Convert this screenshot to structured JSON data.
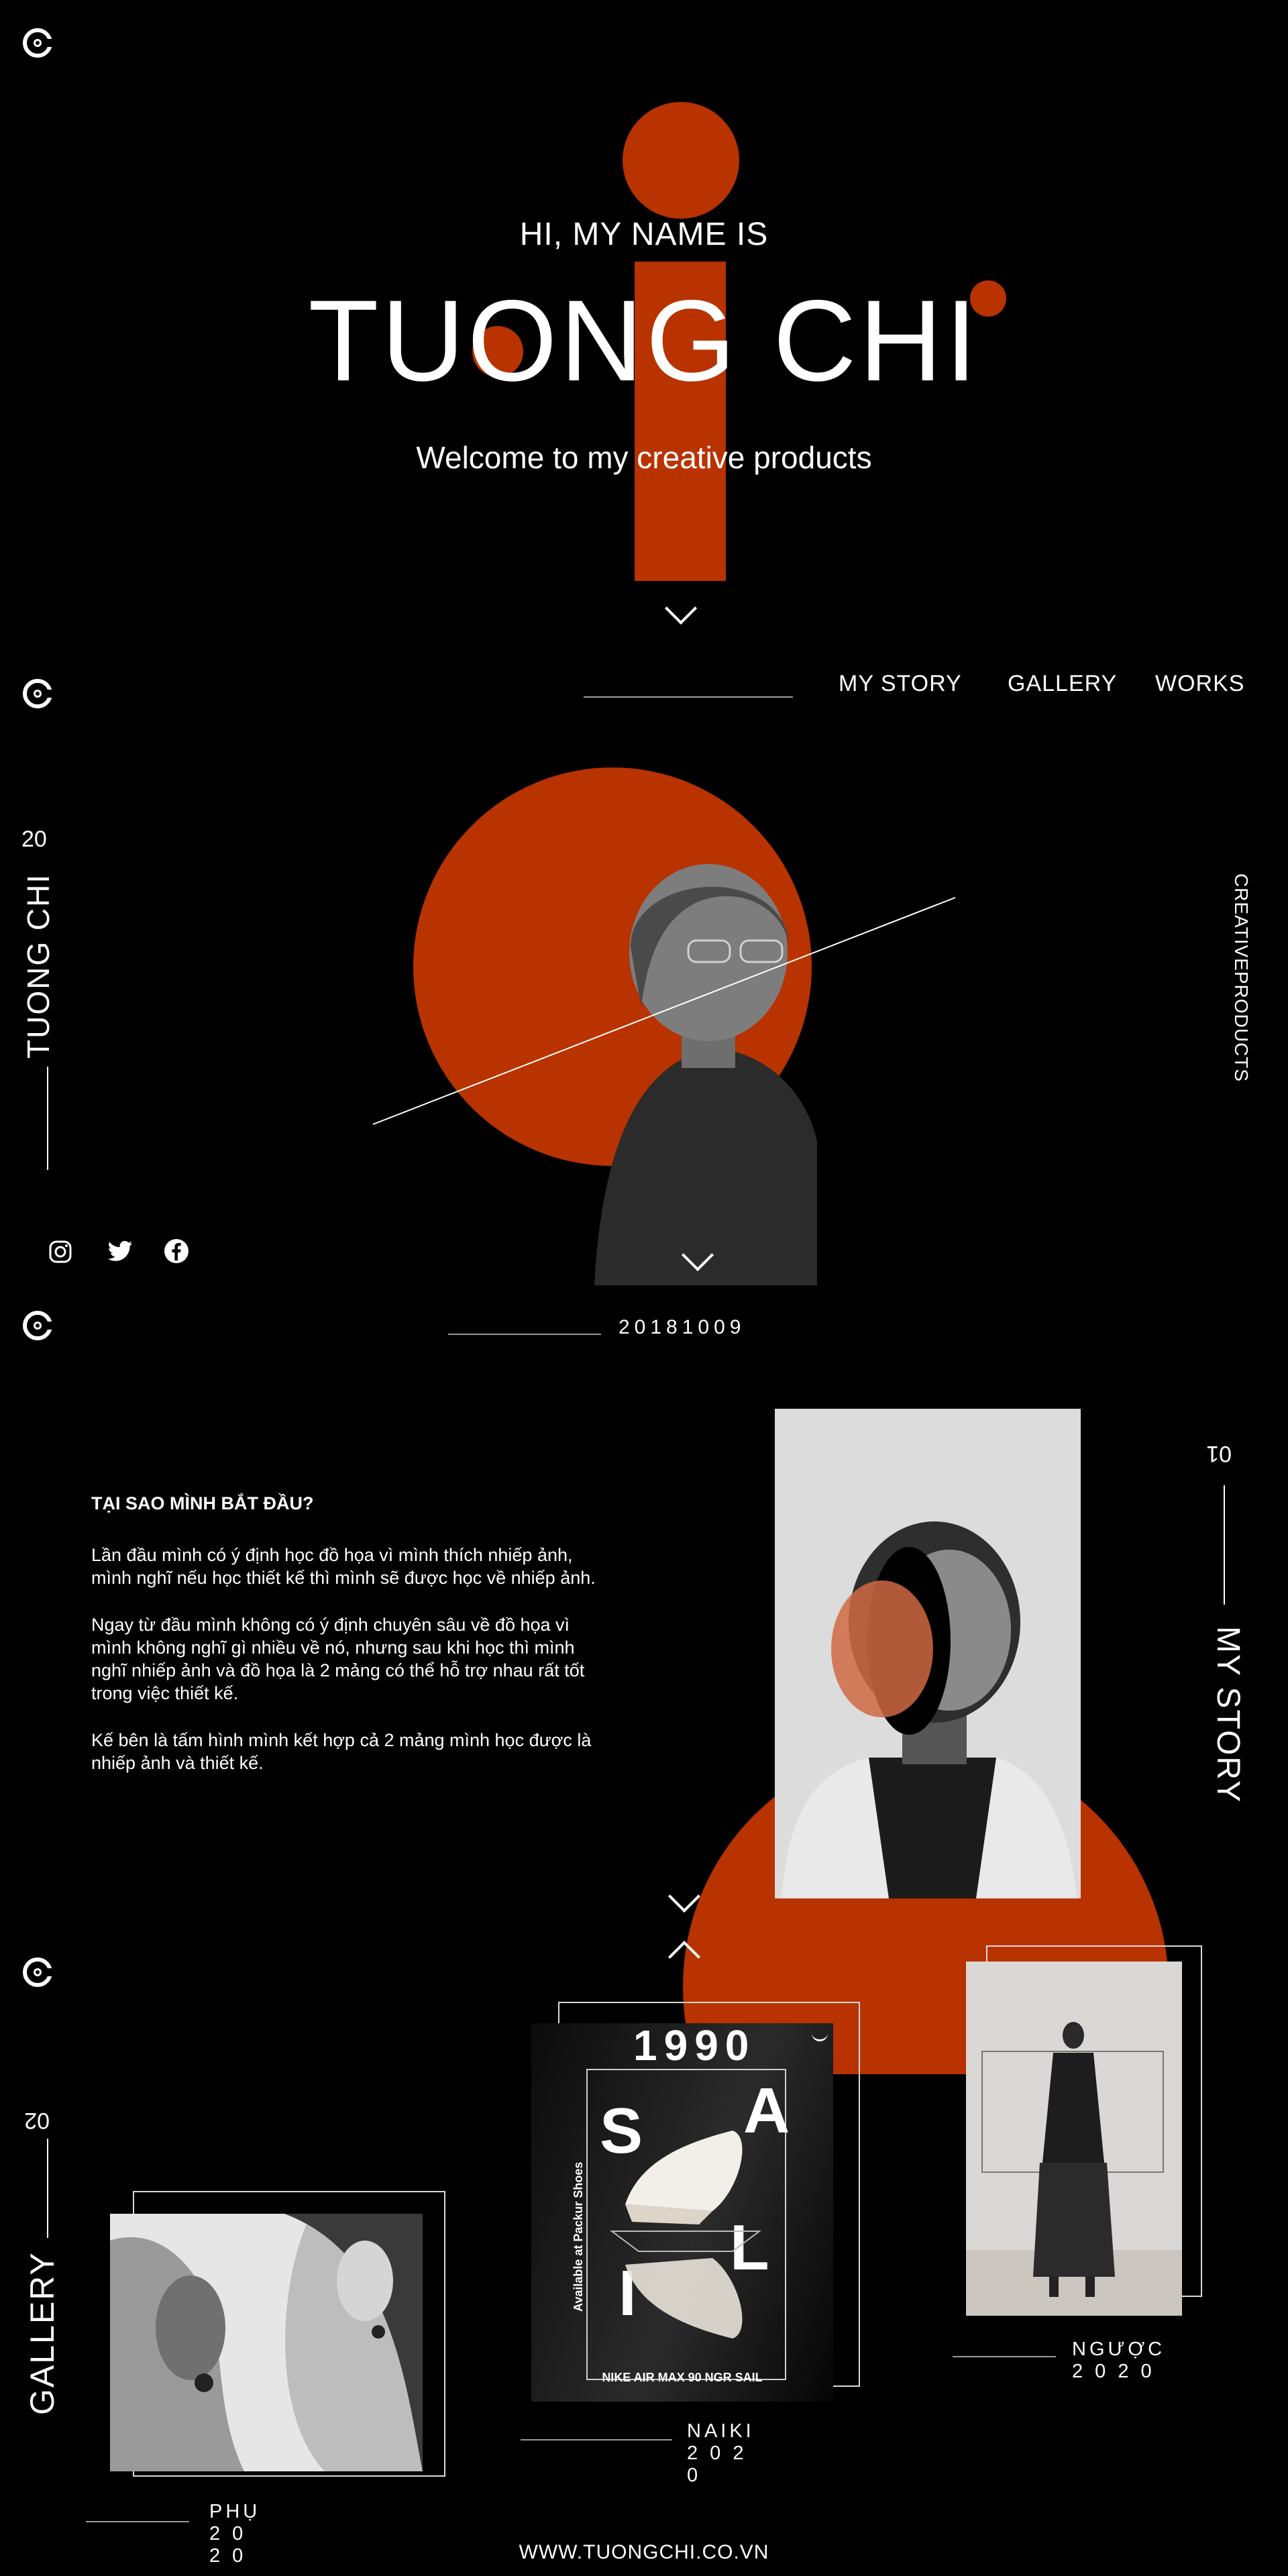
{
  "hero": {
    "greeting": "HI, MY NAME IS",
    "name": "TUONG CHI",
    "tagline": "Welcome to my creative products"
  },
  "nav": {
    "items": [
      "MY STORY",
      "GALLERY",
      "WORKS"
    ]
  },
  "intro": {
    "side_name": "TUONG CHI",
    "side_number": "20",
    "side_right": "CREATIVEPRODUCTS",
    "date": "20181009",
    "social": [
      "instagram-icon",
      "twitter-icon",
      "facebook-icon"
    ]
  },
  "story": {
    "heading": "TẠI SAO MÌNH BẮT ĐẦU?",
    "paragraphs": [
      "Lần đầu mình có ý định học đồ họa vì mình thích nhiếp ảnh, mình nghĩ nếu học thiết kế thì mình sẽ được học về nhiếp ảnh.",
      "Ngay từ đầu mình không có ý định chuyên sâu về đồ họa vì mình không nghĩ gì nhiều về nó, nhưng  sau khi học thì mình nghĩ nhiếp ảnh và đồ họa là 2 mảng có thể hỗ trợ nhau rất tốt trong việc thiết kế.",
      "Kế bên là tấm hình mình kết hợp cả 2 mảng mình học được là nhiếp ảnh và thiết kế."
    ],
    "number": "01",
    "side_title": "MY STORY"
  },
  "gallery": {
    "number": "02",
    "side_title": "GALLERY",
    "items": [
      {
        "caption": "PHỤ 2 0 2 0"
      },
      {
        "caption": "NAIKI 2 0 2 0"
      },
      {
        "caption": "NGƯỢC 2 0 2 0"
      }
    ],
    "poster": {
      "year": "1990",
      "letters": [
        "S",
        "A",
        "L",
        "I"
      ],
      "side_text": "Available at Packur Shoes",
      "product": "NIKE AIR MAX 90 NGR SAIL"
    }
  },
  "footer": {
    "url": "WWW.TUONGCHI.CO.VN"
  },
  "colors": {
    "accent": "#b83300",
    "background": "#000000"
  }
}
